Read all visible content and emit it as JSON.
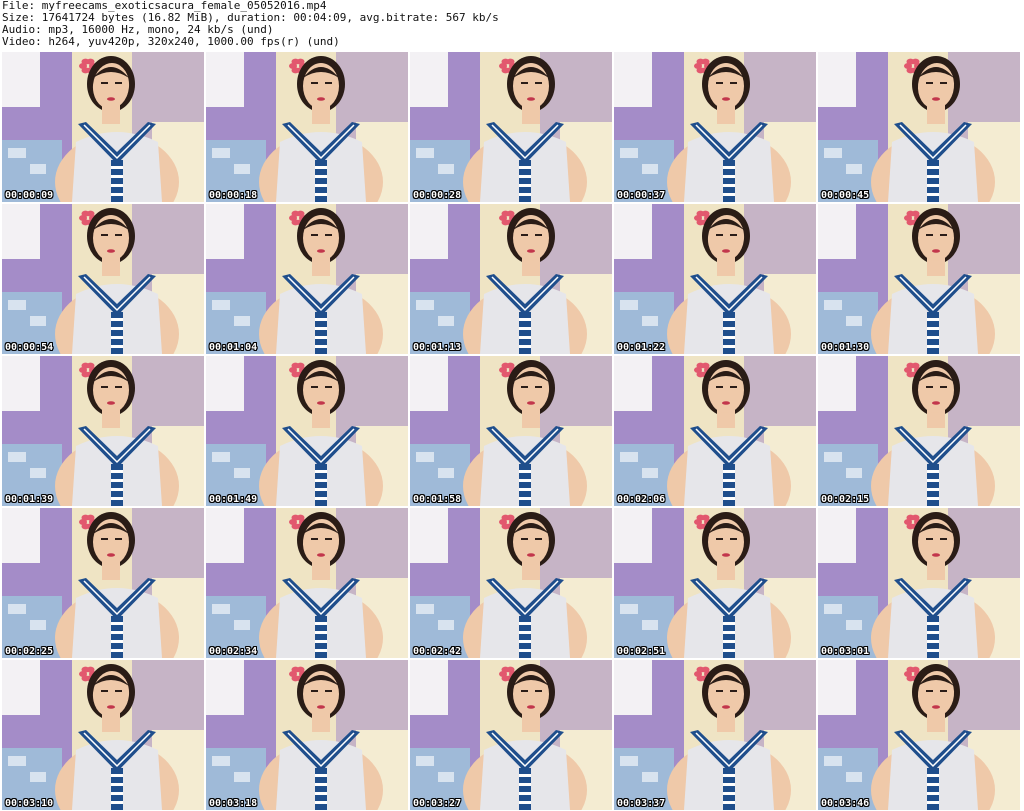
{
  "file_info": {
    "file_line": "File: myfreecams_exoticsacura_female_05052016.mp4",
    "size_line": "Size: 17641724 bytes (16.82 MiB), duration: 00:04:09, avg.bitrate: 567 kb/s",
    "audio_line": "Audio: mp3, 16000 Hz, mono, 24 kb/s (und)",
    "video_line": "Video: h264, yuv420p, 320x240, 1000.00 fps(r) (und)"
  },
  "colors": {
    "wall_purple": "#a48cc8",
    "wall_cream": "#efe4c4",
    "skin": "#efc9a9",
    "hair": "#2a1c16",
    "top_white": "#e6e6ea",
    "collar_blue": "#1f4e8c",
    "flower_pink": "#e2586e",
    "pillow_blue": "#9fbad8",
    "timestamp_text": "#ffffff"
  },
  "thumbnails": [
    {
      "time": "00:00:09"
    },
    {
      "time": "00:00:18"
    },
    {
      "time": "00:00:28"
    },
    {
      "time": "00:00:37"
    },
    {
      "time": "00:00:45"
    },
    {
      "time": "00:00:54"
    },
    {
      "time": "00:01:04"
    },
    {
      "time": "00:01:13"
    },
    {
      "time": "00:01:22"
    },
    {
      "time": "00:01:30"
    },
    {
      "time": "00:01:39"
    },
    {
      "time": "00:01:49"
    },
    {
      "time": "00:01:58"
    },
    {
      "time": "00:02:06"
    },
    {
      "time": "00:02:15"
    },
    {
      "time": "00:02:25"
    },
    {
      "time": "00:02:34"
    },
    {
      "time": "00:02:42"
    },
    {
      "time": "00:02:51"
    },
    {
      "time": "00:03:01"
    },
    {
      "time": "00:03:10"
    },
    {
      "time": "00:03:18"
    },
    {
      "time": "00:03:27"
    },
    {
      "time": "00:03:37"
    },
    {
      "time": "00:03:46"
    }
  ]
}
